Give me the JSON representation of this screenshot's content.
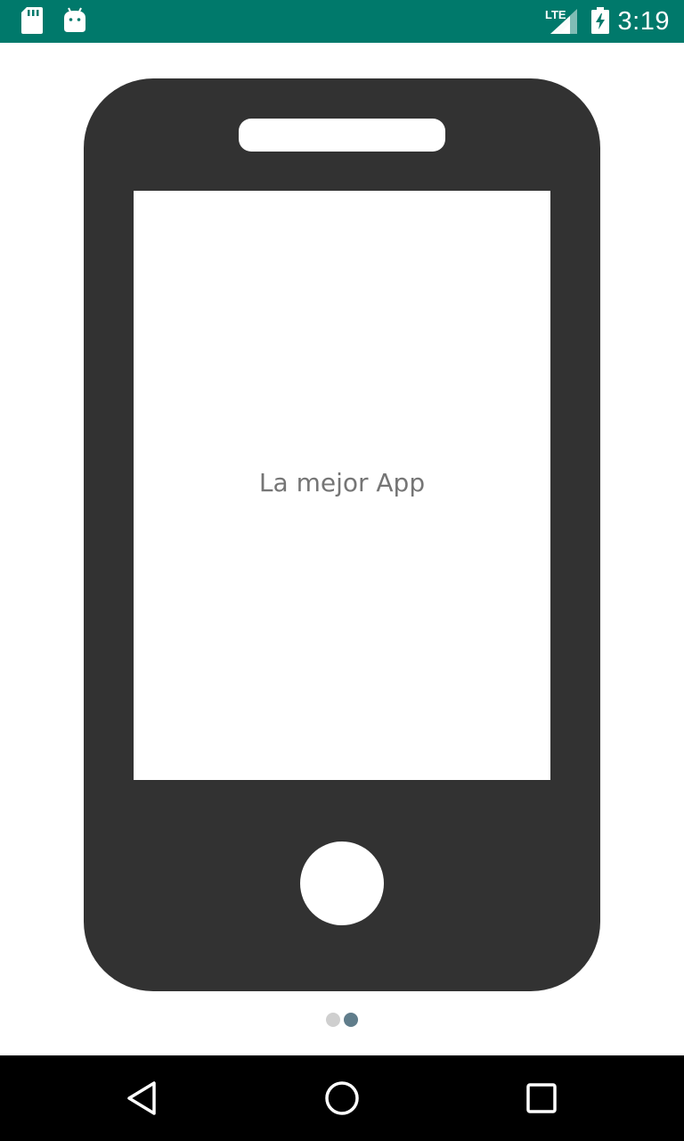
{
  "status_bar": {
    "network_label": "LTE",
    "time": "3:19",
    "background_color": "#00796b",
    "icons": [
      "sd-card-icon",
      "android-icon",
      "signal-icon",
      "battery-charging-icon"
    ]
  },
  "main": {
    "screen_text": "La mejor App",
    "phone_color": "#323232",
    "pager": {
      "total": 2,
      "active_index": 1,
      "active_color": "#607d8b",
      "inactive_color": "#cfcfcf"
    }
  },
  "nav_bar": {
    "icons": [
      "back-icon",
      "home-icon",
      "recents-icon"
    ]
  }
}
